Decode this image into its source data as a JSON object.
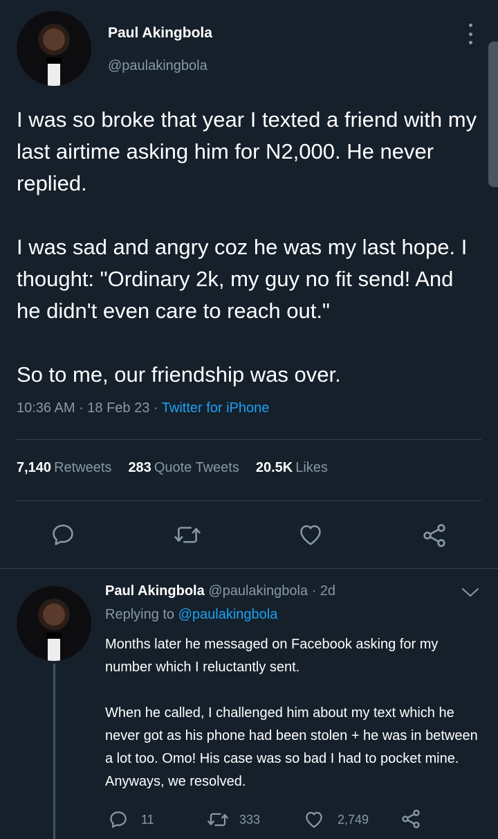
{
  "tweet": {
    "author_name": "Paul Akingbola",
    "author_handle": "@paulakingbola",
    "paragraphs": [
      "I was so broke that year I texted a friend with my last airtime asking him for N2,000. He never replied.",
      "I was sad and angry coz he was my last hope. I thought: \"Ordinary 2k, my guy no fit send! And he didn't even care to reach out.\"",
      "So to me, our friendship was over."
    ],
    "meta_time": "10:36 AM · 18 Feb 23 · ",
    "meta_source": "Twitter for iPhone",
    "stats": {
      "retweets_count": "7,140",
      "retweets_label": "Retweets",
      "quotes_count": "283",
      "quotes_label": "Quote Tweets",
      "likes_count": "20.5K",
      "likes_label": "Likes"
    },
    "actions": [
      "reply-icon",
      "retweet-icon",
      "like-icon",
      "share-icon"
    ]
  },
  "reply": {
    "author_name": "Paul Akingbola",
    "author_handle_time": " @paulakingbola · 2d",
    "replying_prefix": "Replying to ",
    "replying_handle": "@paulakingbola",
    "paragraphs": [
      "Months later he messaged on Facebook asking for my number which I reluctantly sent.",
      "When he called, I challenged him about my text which he never got as his phone had been stolen + he was in between a lot too. Omo! His case was so bad I had to pocket mine. Anyways, we resolved."
    ],
    "reply_count": "11",
    "retweet_count": "333",
    "like_count": "2,749"
  },
  "colors": {
    "background": "#15202b",
    "text": "#ffffff",
    "muted": "#8899a6",
    "accent": "#1da1f2",
    "divider": "#38444d"
  }
}
